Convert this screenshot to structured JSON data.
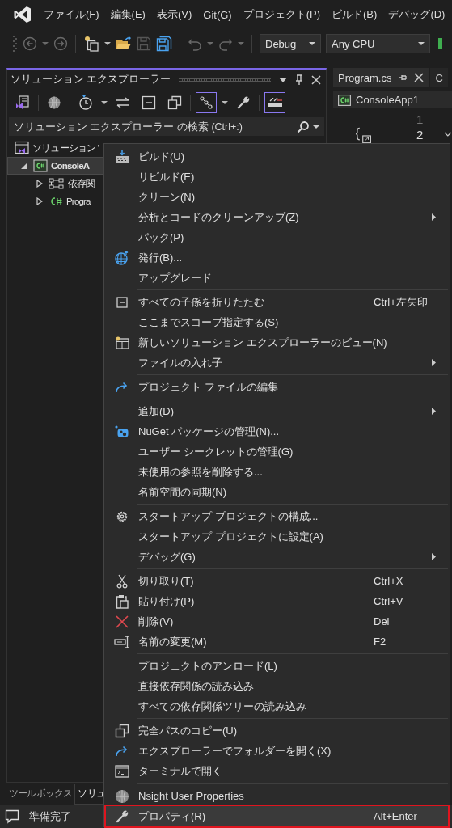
{
  "menu_bar": {
    "items": [
      "ファイル(F)",
      "編集(E)",
      "表示(V)",
      "Git(G)",
      "プロジェクト(P)",
      "ビルド(B)",
      "デバッグ(D)"
    ]
  },
  "toolbar": {
    "configuration": "Debug",
    "platform": "Any CPU"
  },
  "solution_explorer": {
    "title": "ソリューション エクスプローラー",
    "buttons": [
      {
        "on": false
      },
      {
        "on": false
      },
      {
        "on": false
      },
      {
        "on": false
      },
      {
        "on": false
      },
      {
        "on": false
      },
      {
        "on": true
      },
      {
        "on": false
      },
      {
        "on": true
      }
    ],
    "search": {
      "placeholder": "ソリューション エクスプローラー の検索 (Ctrl+:)"
    },
    "tree": [
      {
        "kind": "solution",
        "label": "ソリューション '",
        "selected": false,
        "children": [
          {
            "kind": "project",
            "label": "ConsoleA",
            "selected": true,
            "expanded": true,
            "children": [
              {
                "kind": "dependencies",
                "label": "依存関",
                "selected": false,
                "expanded": false
              },
              {
                "kind": "csharp",
                "label": "Progra",
                "selected": false,
                "expanded": false
              }
            ]
          }
        ]
      }
    ]
  },
  "editor": {
    "tabs": [
      {
        "label": "Program.cs",
        "selected": true
      },
      {
        "label": "C",
        "selected": false
      }
    ],
    "navigation": "ConsoleApp1",
    "line_numbers": [
      {
        "text": "1",
        "selected": false
      },
      {
        "text": "2",
        "selected": true
      }
    ]
  },
  "bottom_tabs": [
    {
      "label": "ツールボックス",
      "selected": false
    },
    {
      "label": "ソリュ",
      "selected": true
    }
  ],
  "status_bar": {
    "text": "準備完了"
  },
  "context_menu": {
    "items": [
      {
        "kind": "item",
        "label": "ビルド(U)",
        "submenu": false,
        "selected": false
      },
      {
        "kind": "item",
        "label": "リビルド(E)",
        "submenu": false,
        "selected": false
      },
      {
        "kind": "item",
        "label": "クリーン(N)",
        "submenu": false,
        "selected": false
      },
      {
        "kind": "item",
        "label": "分析とコードのクリーンアップ(Z)",
        "submenu": true,
        "selected": false
      },
      {
        "kind": "item",
        "label": "パック(P)",
        "submenu": false,
        "selected": false
      },
      {
        "kind": "item",
        "label": "発行(B)...",
        "submenu": false,
        "selected": false
      },
      {
        "kind": "item",
        "label": "アップグレード",
        "submenu": false,
        "selected": false
      },
      {
        "kind": "separator"
      },
      {
        "kind": "item",
        "label": "すべての子孫を折りたたむ",
        "shortcut": "Ctrl+左矢印",
        "submenu": false,
        "selected": false
      },
      {
        "kind": "item",
        "label": "ここまでスコープ指定する(S)",
        "submenu": false,
        "selected": false
      },
      {
        "kind": "item",
        "label": "新しいソリューション エクスプローラーのビュー(N)",
        "submenu": false,
        "selected": false
      },
      {
        "kind": "item",
        "label": "ファイルの入れ子",
        "submenu": true,
        "selected": false
      },
      {
        "kind": "separator"
      },
      {
        "kind": "item",
        "label": "プロジェクト ファイルの編集",
        "submenu": false,
        "selected": false
      },
      {
        "kind": "separator"
      },
      {
        "kind": "item",
        "label": "追加(D)",
        "submenu": true,
        "selected": false
      },
      {
        "kind": "item",
        "label": "NuGet パッケージの管理(N)...",
        "submenu": false,
        "selected": false
      },
      {
        "kind": "item",
        "label": "ユーザー シークレットの管理(G)",
        "submenu": false,
        "selected": false
      },
      {
        "kind": "item",
        "label": "未使用の参照を削除する...",
        "submenu": false,
        "selected": false
      },
      {
        "kind": "item",
        "label": "名前空間の同期(N)",
        "submenu": false,
        "selected": false
      },
      {
        "kind": "separator"
      },
      {
        "kind": "item",
        "label": "スタートアップ プロジェクトの構成...",
        "submenu": false,
        "selected": false
      },
      {
        "kind": "item",
        "label": "スタートアップ プロジェクトに設定(A)",
        "submenu": false,
        "selected": false
      },
      {
        "kind": "item",
        "label": "デバッグ(G)",
        "submenu": true,
        "selected": false
      },
      {
        "kind": "separator"
      },
      {
        "kind": "item",
        "label": "切り取り(T)",
        "shortcut": "Ctrl+X",
        "submenu": false,
        "selected": false
      },
      {
        "kind": "item",
        "label": "貼り付け(P)",
        "shortcut": "Ctrl+V",
        "submenu": false,
        "selected": false
      },
      {
        "kind": "item",
        "label": "削除(V)",
        "shortcut": "Del",
        "submenu": false,
        "selected": false
      },
      {
        "kind": "item",
        "label": "名前の変更(M)",
        "shortcut": "F2",
        "submenu": false,
        "selected": false
      },
      {
        "kind": "separator"
      },
      {
        "kind": "item",
        "label": "プロジェクトのアンロード(L)",
        "submenu": false,
        "selected": false
      },
      {
        "kind": "item",
        "label": "直接依存関係の読み込み",
        "submenu": false,
        "selected": false
      },
      {
        "kind": "item",
        "label": "すべての依存関係ツリーの読み込み",
        "submenu": false,
        "selected": false
      },
      {
        "kind": "separator"
      },
      {
        "kind": "item",
        "label": "完全パスのコピー(U)",
        "submenu": false,
        "selected": false
      },
      {
        "kind": "item",
        "label": "エクスプローラーでフォルダーを開く(X)",
        "submenu": false,
        "selected": false
      },
      {
        "kind": "item",
        "label": "ターミナルで開く",
        "submenu": false,
        "selected": false
      },
      {
        "kind": "separator"
      },
      {
        "kind": "item",
        "label": "Nsight User Properties",
        "submenu": false,
        "selected": false
      },
      {
        "kind": "item",
        "label": "プロパティ(R)",
        "shortcut": "Alt+Enter",
        "submenu": false,
        "selected": true
      }
    ]
  }
}
